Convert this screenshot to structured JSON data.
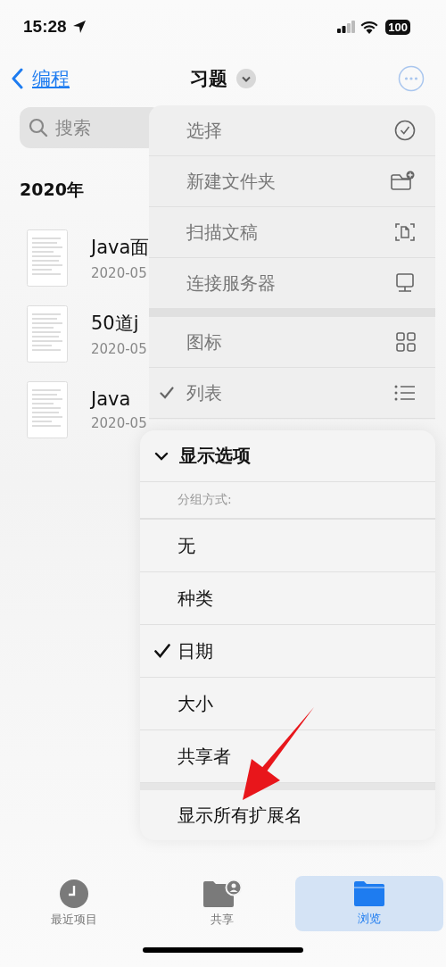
{
  "status_bar": {
    "time": "15:28",
    "battery": "100"
  },
  "nav": {
    "back": "编程",
    "title": "习题"
  },
  "search": {
    "placeholder": "搜索"
  },
  "section": "2020年",
  "files": [
    {
      "name": "Java面",
      "date": "2020-05"
    },
    {
      "name": "50道j",
      "date": "2020-05"
    },
    {
      "name": "Java",
      "date": "2020-05"
    }
  ],
  "menu": {
    "groups": [
      [
        {
          "label": "选择",
          "checked": false
        },
        {
          "label": "新建文件夹",
          "checked": false
        },
        {
          "label": "扫描文稿",
          "checked": false
        },
        {
          "label": "连接服务器",
          "checked": false
        }
      ],
      [
        {
          "label": "图标",
          "checked": false
        },
        {
          "label": "列表",
          "checked": true
        }
      ]
    ]
  },
  "options": {
    "title": "显示选项",
    "expanded": true,
    "group_label": "分组方式:",
    "items": [
      {
        "label": "无",
        "checked": false
      },
      {
        "label": "种类",
        "checked": false
      },
      {
        "label": "日期",
        "checked": true
      },
      {
        "label": "大小",
        "checked": false
      },
      {
        "label": "共享者",
        "checked": false
      }
    ],
    "extra": "显示所有扩展名"
  },
  "tabs": [
    {
      "label": "最近项目",
      "selected": false
    },
    {
      "label": "共享",
      "selected": false
    },
    {
      "label": "浏览",
      "selected": true
    }
  ]
}
